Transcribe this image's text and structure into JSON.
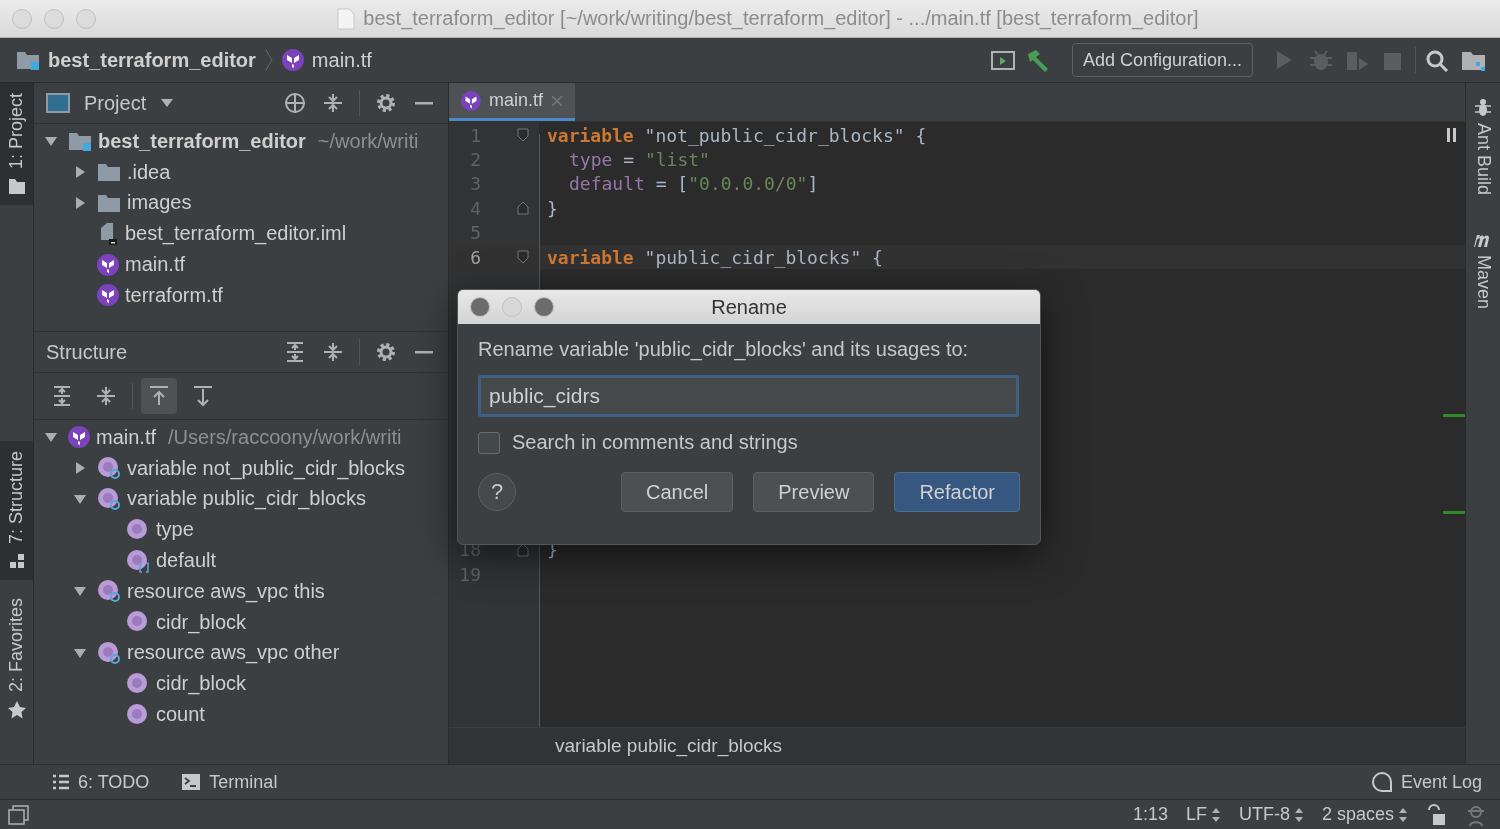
{
  "window": {
    "title": "best_terraform_editor [~/work/writing/best_terraform_editor] - .../main.tf [best_terraform_editor]"
  },
  "navbar": {
    "crumbs": [
      "best_terraform_editor",
      "main.tf"
    ],
    "run_config": "Add Configuration..."
  },
  "left_stripe": [
    {
      "label": "1: Project",
      "selected": true
    },
    {
      "label": "7: Structure",
      "selected": true
    },
    {
      "label": "2: Favorites",
      "selected": false
    }
  ],
  "project_panel": {
    "title": "Project",
    "tree": [
      {
        "name": "best_terraform_editor",
        "path": "~/work/writi",
        "kind": "module",
        "expanded": true,
        "children": [
          {
            "name": ".idea",
            "kind": "folder",
            "expanded": false
          },
          {
            "name": "images",
            "kind": "folder",
            "expanded": false
          },
          {
            "name": "best_terraform_editor.iml",
            "kind": "iml"
          },
          {
            "name": "main.tf",
            "kind": "terraform"
          },
          {
            "name": "terraform.tf",
            "kind": "terraform"
          }
        ]
      }
    ]
  },
  "structure_panel": {
    "title": "Structure",
    "sort_buttons": [
      {
        "selected": false
      },
      {
        "selected": false
      },
      {
        "selected": true
      },
      {
        "selected": false
      }
    ],
    "tree": [
      {
        "name": "main.tf",
        "path": "/Users/raccoony/work/writi",
        "kind": "terraform",
        "expanded": true,
        "children": [
          {
            "name": "variable not_public_cidr_blocks",
            "kind": "block",
            "expanded": false
          },
          {
            "name": "variable public_cidr_blocks",
            "kind": "block",
            "expanded": true,
            "children": [
              {
                "name": "type",
                "kind": "property"
              },
              {
                "name": "default",
                "kind": "list"
              }
            ]
          },
          {
            "name": "resource aws_vpc this",
            "kind": "block",
            "expanded": true,
            "children": [
              {
                "name": "cidr_block",
                "kind": "property"
              }
            ]
          },
          {
            "name": "resource aws_vpc other",
            "kind": "block",
            "expanded": true,
            "children": [
              {
                "name": "cidr_block",
                "kind": "property"
              },
              {
                "name": "count",
                "kind": "property"
              }
            ]
          }
        ]
      }
    ]
  },
  "editor": {
    "tab": "main.tf",
    "lines": [
      {
        "number": "1",
        "fold_start": true,
        "current": false,
        "tokens": [
          {
            "kind": "keyword",
            "text": "variable"
          },
          {
            "kind": "plain",
            "text": " \"not_public_cidr_blocks\" {"
          }
        ]
      },
      {
        "number": "2",
        "current": false,
        "indented": true,
        "tokens": [
          {
            "kind": "prop",
            "text": "type"
          },
          {
            "kind": "plain",
            "text": " = "
          },
          {
            "kind": "string",
            "text": "\"list\""
          }
        ]
      },
      {
        "number": "3",
        "current": false,
        "indented": true,
        "tokens": [
          {
            "kind": "prop",
            "text": "default"
          },
          {
            "kind": "plain",
            "text": " = ["
          },
          {
            "kind": "string",
            "text": "\"0.0.0.0/0\""
          },
          {
            "kind": "plain",
            "text": "]"
          }
        ]
      },
      {
        "number": "4",
        "fold_end": true,
        "current": false,
        "tokens": [
          {
            "kind": "plain",
            "text": "}"
          }
        ]
      },
      {
        "number": "5",
        "current": false
      },
      {
        "number": "6",
        "fold_start": true,
        "current": true,
        "tokens": [
          {
            "kind": "keyword",
            "text": "variable"
          },
          {
            "kind": "plain",
            "text": " \"public_cidr_blocks\" {"
          }
        ]
      },
      {
        "number": "18",
        "fold_end": true,
        "current": false,
        "tokens": [
          {
            "kind": "plain",
            "text": "}"
          }
        ]
      },
      {
        "number": "19",
        "current": false
      }
    ],
    "breadcrumb": "variable public_cidr_blocks"
  },
  "right_stripe": [
    "Ant Build",
    "Maven"
  ],
  "dialog": {
    "title": "Rename",
    "prompt": "Rename variable 'public_cidr_blocks' and its usages to:",
    "value": "public_cidrs",
    "option": {
      "label": "Search in comments and strings",
      "checked": false
    },
    "help": "?",
    "buttons": [
      {
        "label": "Cancel",
        "default": false
      },
      {
        "label": "Preview",
        "default": false
      },
      {
        "label": "Refactor",
        "default": true
      }
    ]
  },
  "bottom_bar": {
    "tools": [
      "6: TODO",
      "Terminal"
    ],
    "event_log": "Event Log"
  },
  "status_bar": {
    "items": [
      {
        "text": "1:13",
        "dropdown": false
      },
      {
        "text": "LF",
        "dropdown": true
      },
      {
        "text": "UTF-8",
        "dropdown": true
      },
      {
        "text": "2 spaces",
        "dropdown": true
      }
    ]
  }
}
